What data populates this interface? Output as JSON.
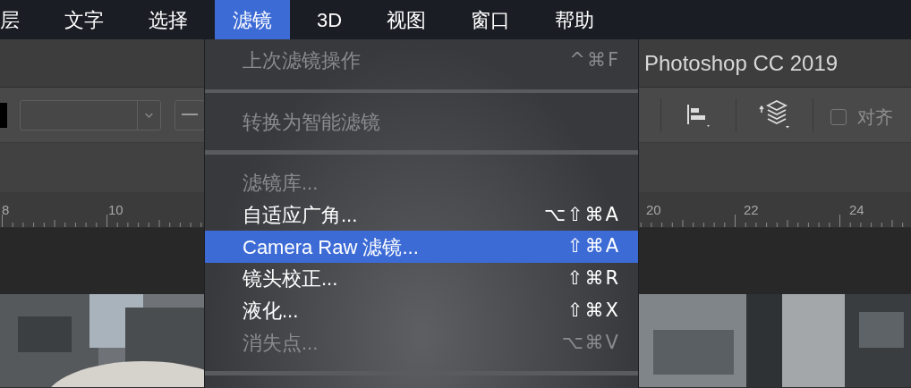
{
  "menubar": {
    "items": [
      {
        "label": "层",
        "selected": false
      },
      {
        "label": "文字",
        "selected": false
      },
      {
        "label": "选择",
        "selected": false
      },
      {
        "label": "滤镜",
        "selected": true
      },
      {
        "label": "3D",
        "selected": false
      },
      {
        "label": "视图",
        "selected": false
      },
      {
        "label": "窗口",
        "selected": false
      },
      {
        "label": "帮助",
        "selected": false
      }
    ]
  },
  "window": {
    "title": "Photoshop CC 2019"
  },
  "options_bar": {
    "align_checkbox": {
      "label": "对齐",
      "checked": false
    }
  },
  "ruler": {
    "labels": [
      "8",
      "10",
      "20",
      "22",
      "24"
    ]
  },
  "filter_menu": {
    "items": [
      {
        "kind": "item",
        "label": "上次滤镜操作",
        "shortcut": "^⌘F",
        "disabled": true,
        "selected": false
      },
      {
        "kind": "separator"
      },
      {
        "kind": "item",
        "label": "转换为智能滤镜",
        "disabled": true,
        "selected": false
      },
      {
        "kind": "separator"
      },
      {
        "kind": "item",
        "label": "滤镜库...",
        "disabled": true,
        "selected": false
      },
      {
        "kind": "item",
        "label": "自适应广角...",
        "shortcut": "⌥⇧⌘A",
        "disabled": false,
        "selected": false
      },
      {
        "kind": "item",
        "label": "Camera Raw 滤镜...",
        "shortcut": "⇧⌘A",
        "disabled": false,
        "selected": true
      },
      {
        "kind": "item",
        "label": "镜头校正...",
        "shortcut": "⇧⌘R",
        "disabled": false,
        "selected": false
      },
      {
        "kind": "item",
        "label": "液化...",
        "shortcut": "⇧⌘X",
        "disabled": false,
        "selected": false
      },
      {
        "kind": "item",
        "label": "消失点...",
        "shortcut": "⌥⌘V",
        "disabled": true,
        "selected": false
      },
      {
        "kind": "separator"
      }
    ]
  }
}
